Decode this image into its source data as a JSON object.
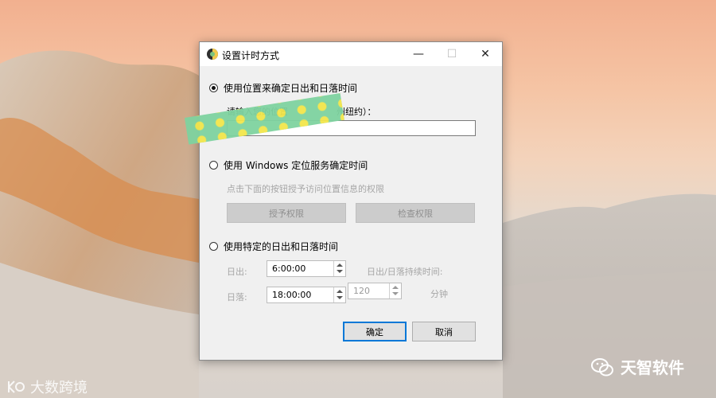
{
  "dialog": {
    "title": "设置计时方式",
    "option_location": "使用位置来确定日出和日落时间",
    "location_prompt_visible_start": "请输入您的位置",
    "location_prompt_visible_end": "州纽约）：",
    "location_value": "",
    "option_windows": "使用 Windows 定位服务确定时间",
    "windows_hint": "点击下面的按钮授予访问位置信息的权限",
    "grant_button": "授予权限",
    "check_button": "检查权限",
    "option_specific": "使用特定的日出和日落时间",
    "sunrise_label": "日出:",
    "sunrise_value": "6:00:00",
    "sunset_label": "日落:",
    "sunset_value": "18:00:00",
    "duration_label": "日出/日落持续时间:",
    "duration_value": "120",
    "duration_unit": "分钟",
    "ok_button": "确定",
    "cancel_button": "取消",
    "selected_option": "location"
  },
  "watermarks": {
    "left": "大数跨境",
    "right": "天智软件"
  },
  "colors": {
    "primary_border": "#0078d7",
    "dialog_bg": "#f0f0f0",
    "disabled_text": "#a6a6a6"
  }
}
